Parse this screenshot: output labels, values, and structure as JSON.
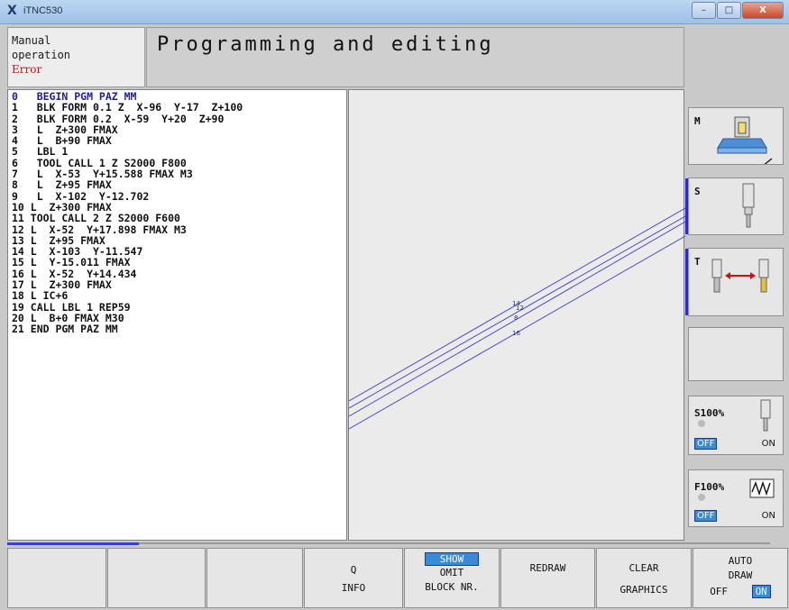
{
  "window": {
    "title": "iTNC530",
    "logo": "X",
    "close_label": "X"
  },
  "header": {
    "mode_line1": "Manual",
    "mode_line2": "operation",
    "mode_status": "Error",
    "title": "Programming and editing"
  },
  "program": {
    "lines": [
      "0   BEGIN PGM PAZ MM",
      "1   BLK FORM 0.1 Z  X-96  Y-17  Z+100",
      "2   BLK FORM 0.2  X-59  Y+20  Z+90",
      "3   L  Z+300 FMAX",
      "4   L  B+90 FMAX",
      "5   LBL 1",
      "6   TOOL CALL 1 Z S2000 F800",
      "7   L  X-53  Y+15.588 FMAX M3",
      "8   L  Z+95 FMAX",
      "9   L  X-102  Y-12.702",
      "10 L  Z+300 FMAX",
      "11 TOOL CALL 2 Z S2000 F600",
      "12 L  X-52  Y+17.898 FMAX M3",
      "13 L  Z+95 FMAX",
      "14 L  X-103  Y-11.547",
      "15 L  Y-15.011 FMAX",
      "16 L  X-52  Y+14.434",
      "17 L  Z+300 FMAX",
      "18 L IC+6",
      "19 CALL LBL 1 REP59",
      "20 L  B+0 FMAX M30",
      "21 END PGM PAZ MM"
    ]
  },
  "graphics": {
    "labels": [
      "14",
      "12",
      "8",
      "16"
    ],
    "line_color": "#3a3ad0"
  },
  "vertical_softkeys": {
    "m_label": "M",
    "s_label": "S",
    "t_label": "T",
    "spindle_override": {
      "label": "S100%",
      "off": "OFF",
      "on": "ON"
    },
    "feed_override": {
      "label": "F100%",
      "off": "OFF",
      "on": "ON"
    }
  },
  "softkeys": {
    "q_info": [
      "Q",
      "INFO"
    ],
    "show_omit": [
      "SHOW",
      "OMIT",
      "BLOCK NR."
    ],
    "redraw": "REDRAW",
    "clear_graphics": [
      "CLEAR",
      "GRAPHICS"
    ],
    "auto_draw": [
      "AUTO",
      "DRAW",
      "OFF",
      "ON"
    ]
  },
  "colors": {
    "accent": "#3a8ad8",
    "highlight_text": "#1c1ca8",
    "error": "#c01818"
  }
}
